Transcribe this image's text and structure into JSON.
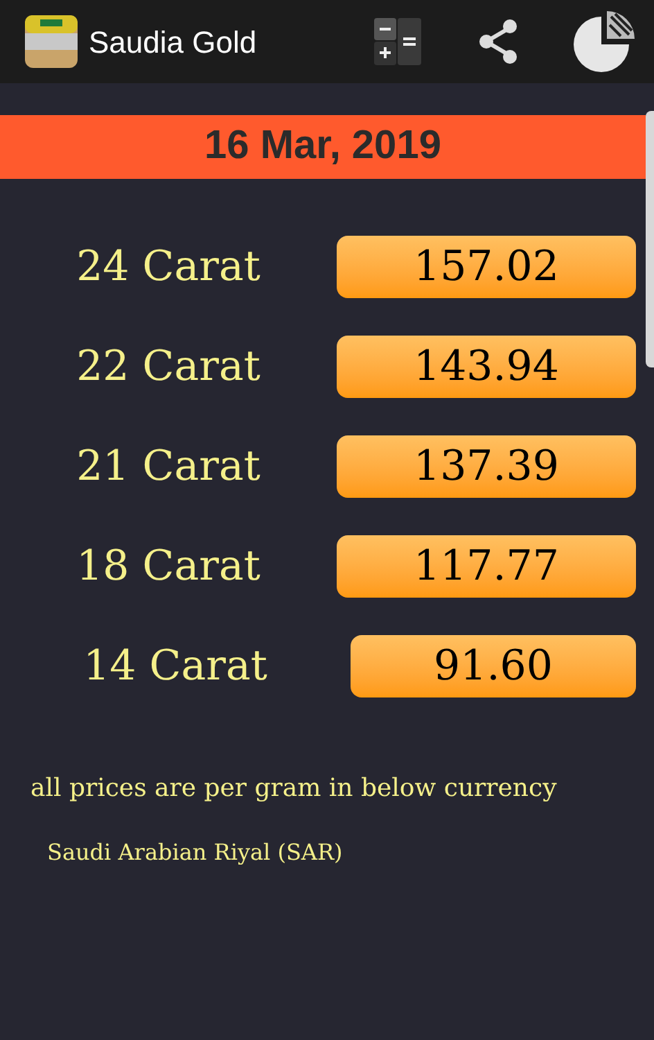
{
  "app_bar": {
    "title": "Saudia Gold"
  },
  "date": "16 Mar, 2019",
  "prices": [
    {
      "label": "24 Carat",
      "value": "157.02"
    },
    {
      "label": "22 Carat",
      "value": "143.94"
    },
    {
      "label": "21 Carat",
      "value": "137.39"
    },
    {
      "label": "18 Carat",
      "value": "117.77"
    },
    {
      "label": "14 Carat",
      "value": "91.60"
    }
  ],
  "note": "all prices are per gram in below currency",
  "currency": "Saudi Arabian Riyal (SAR)"
}
